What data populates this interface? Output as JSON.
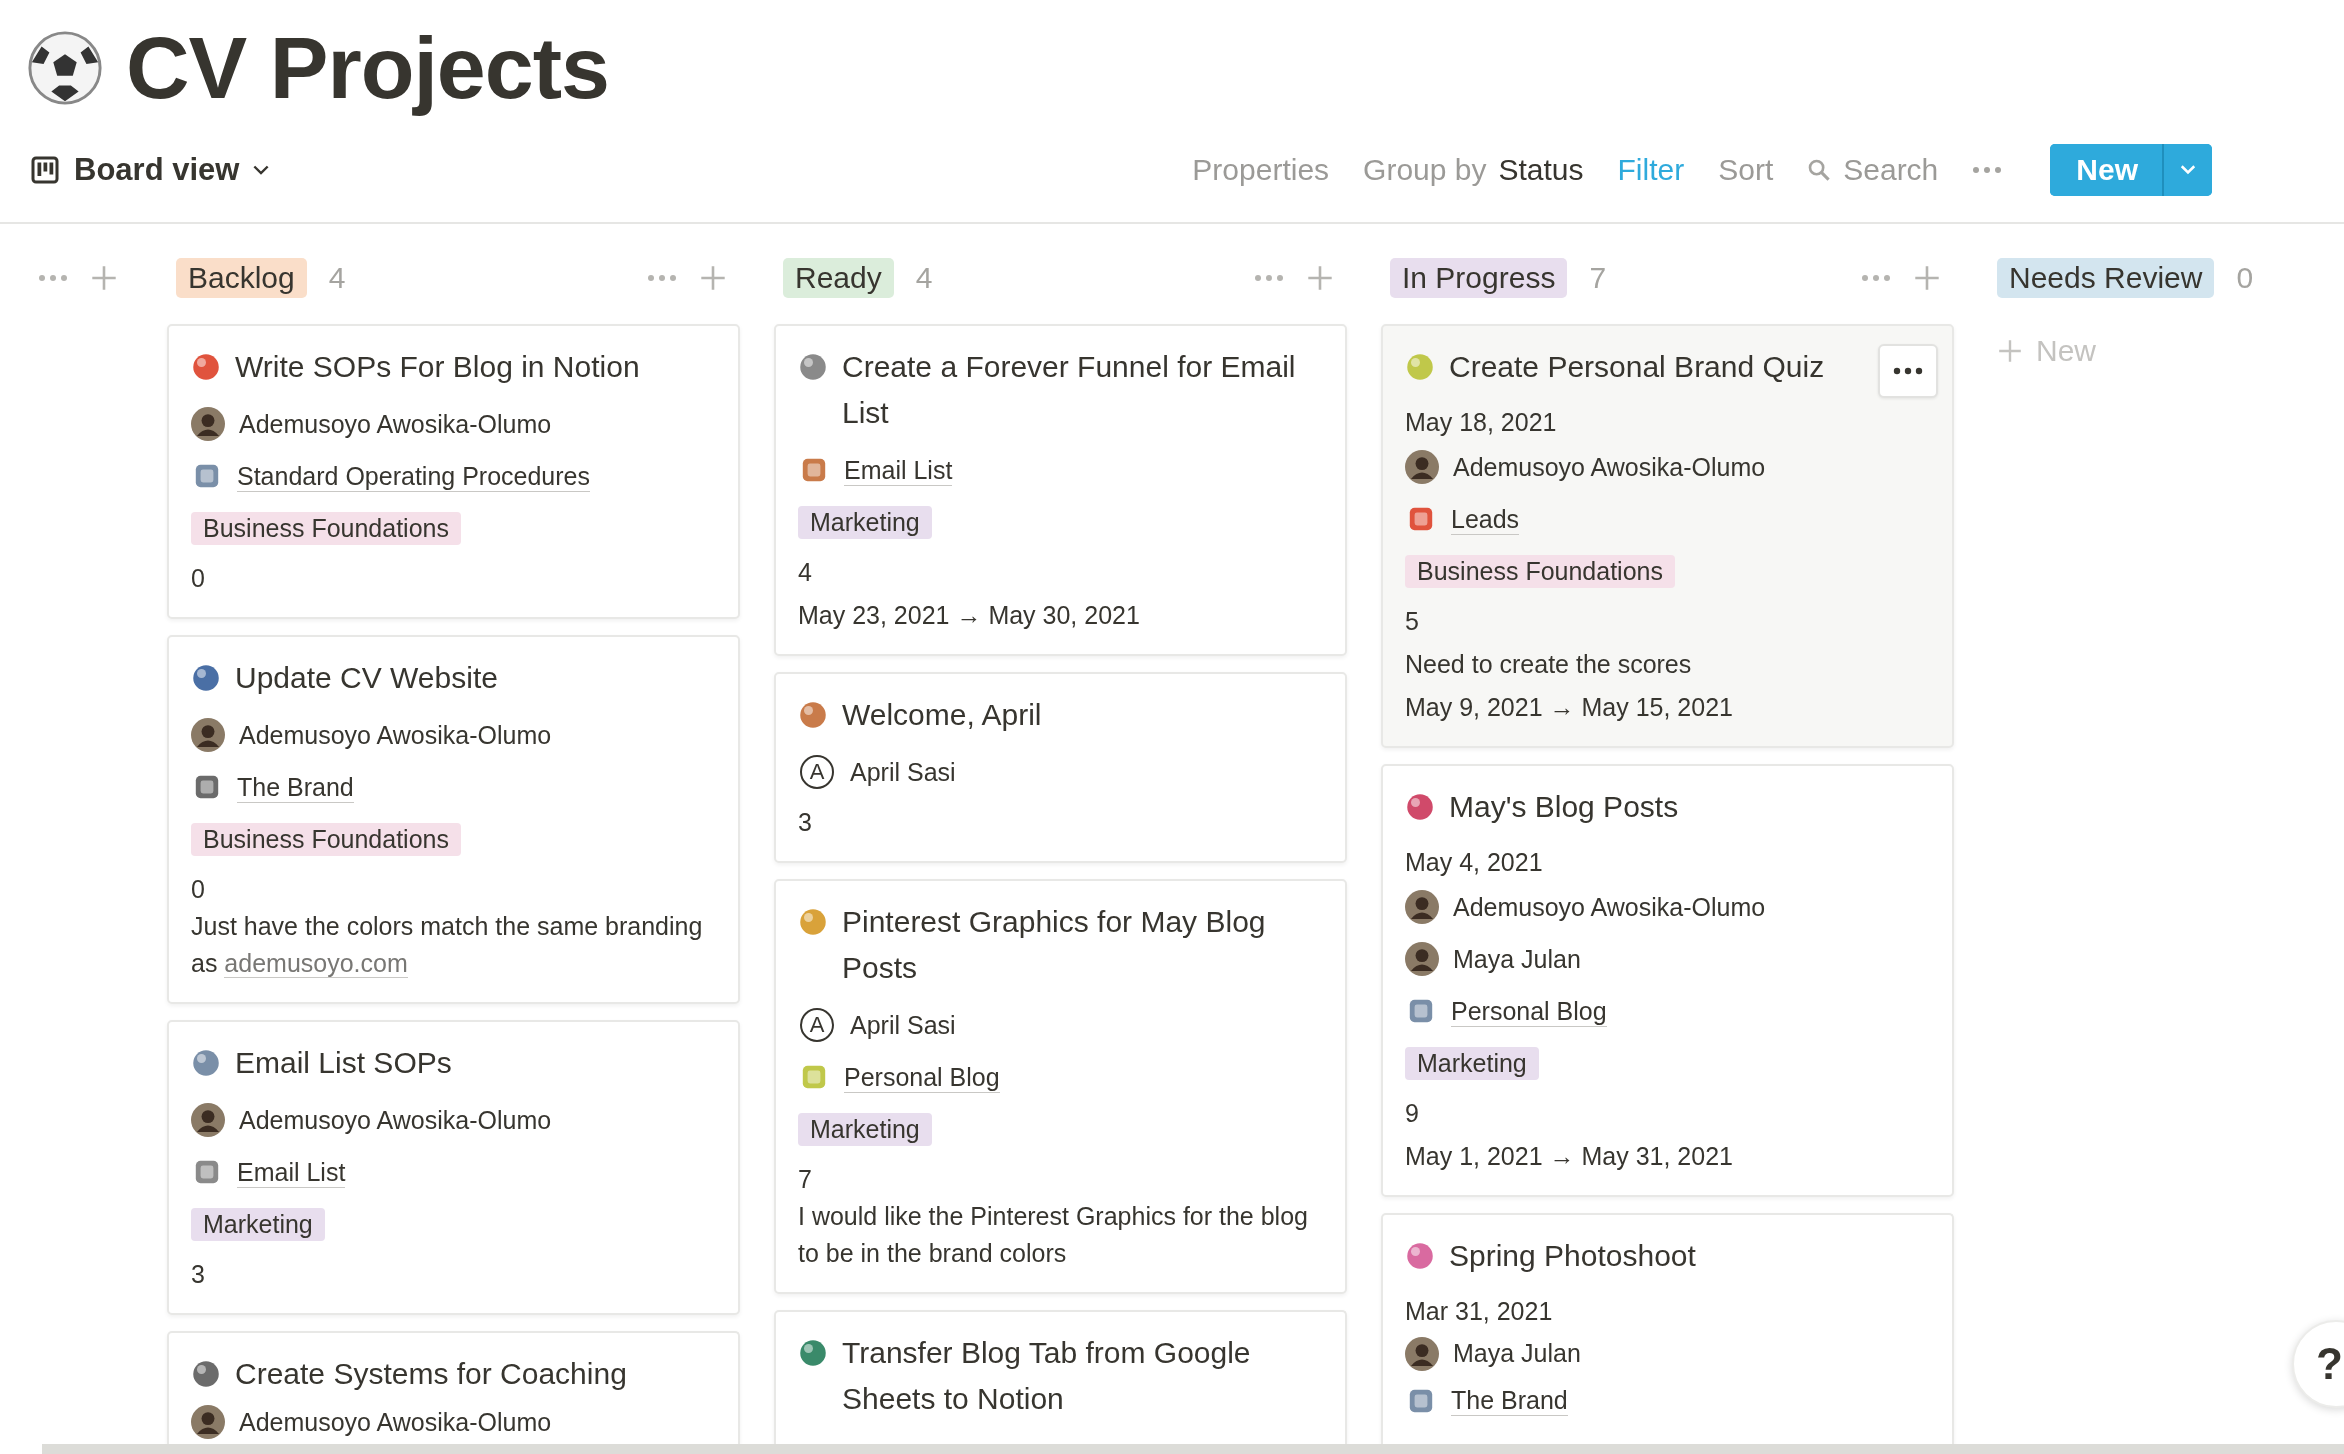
{
  "page": {
    "title": "CV Projects"
  },
  "toolbar": {
    "view": "Board view",
    "items": [
      {
        "kind": "plain",
        "label": "Properties"
      },
      {
        "kind": "group",
        "label": "Group by",
        "value": "Status"
      },
      {
        "kind": "active",
        "label": "Filter"
      },
      {
        "kind": "plain",
        "label": "Sort"
      },
      {
        "kind": "search",
        "label": "Search"
      }
    ],
    "new_button": "New"
  },
  "columns": [
    {
      "name": "Backlog",
      "color": "#fadec9",
      "count": "4",
      "cards": [
        {
          "title": "Write SOPs For Blog in Notion",
          "hovered": false,
          "props": [
            {
              "kind": "person",
              "name": "Ademusoyo Awosika-Olumo"
            },
            {
              "kind": "relation",
              "text": "Standard Operating Procedures"
            },
            {
              "kind": "tag",
              "text": "Business Foundations",
              "color": "#f5e0e9"
            },
            {
              "kind": "text",
              "text": "0"
            }
          ]
        },
        {
          "title": "Update CV Website",
          "hovered": false,
          "props": [
            {
              "kind": "person",
              "name": "Ademusoyo Awosika-Olumo"
            },
            {
              "kind": "relation",
              "text": "The Brand"
            },
            {
              "kind": "tag",
              "text": "Business Foundations",
              "color": "#f5e0e9"
            },
            {
              "kind": "text",
              "text": "0"
            },
            {
              "kind": "note",
              "text": "Just have the colors match the same branding as",
              "link": "ademusoyo.com"
            }
          ]
        },
        {
          "title": "Email List SOPs",
          "hovered": false,
          "props": [
            {
              "kind": "person",
              "name": "Ademusoyo Awosika-Olumo"
            },
            {
              "kind": "relation",
              "text": "Email List"
            },
            {
              "kind": "tag",
              "text": "Marketing",
              "color": "#e8deee"
            },
            {
              "kind": "text",
              "text": "3"
            }
          ]
        },
        {
          "title": "Create Systems for Coaching",
          "hovered": false,
          "props": [
            {
              "kind": "person",
              "name": "Ademusoyo Awosika-Olumo"
            }
          ]
        }
      ]
    },
    {
      "name": "Ready",
      "color": "#dbeddb",
      "count": "4",
      "cards": [
        {
          "title": "Create a Forever Funnel for Email List",
          "hovered": false,
          "props": [
            {
              "kind": "relation",
              "text": "Email List"
            },
            {
              "kind": "tag",
              "text": "Marketing",
              "color": "#e8deee"
            },
            {
              "kind": "text",
              "text": "4"
            },
            {
              "kind": "text",
              "text": "May 23, 2021 → May 30, 2021"
            }
          ]
        },
        {
          "title": "Welcome, April",
          "hovered": false,
          "props": [
            {
              "kind": "person",
              "name": "April Sasi",
              "initial": "A"
            },
            {
              "kind": "text",
              "text": "3"
            }
          ]
        },
        {
          "title": "Pinterest Graphics for May Blog Posts",
          "hovered": false,
          "props": [
            {
              "kind": "person",
              "name": "April Sasi",
              "initial": "A"
            },
            {
              "kind": "relation",
              "text": "Personal Blog"
            },
            {
              "kind": "tag",
              "text": "Marketing",
              "color": "#e8deee"
            },
            {
              "kind": "text",
              "text": "7"
            },
            {
              "kind": "note",
              "text": "I would like the Pinterest Graphics for the blog to be in the brand colors"
            }
          ]
        },
        {
          "title": "Transfer Blog Tab from Google Sheets to Notion",
          "hovered": false
        }
      ]
    },
    {
      "name": "In Progress",
      "color": "#e8deee",
      "count": "7",
      "cards": [
        {
          "title": "Create Personal Brand Quiz",
          "hovered": true,
          "props": [
            {
              "kind": "text",
              "text": "May 18, 2021"
            },
            {
              "kind": "person",
              "name": "Ademusoyo Awosika-Olumo"
            },
            {
              "kind": "relation",
              "text": "Leads"
            },
            {
              "kind": "tag",
              "text": "Business Foundations",
              "color": "#f5e0e9"
            },
            {
              "kind": "text",
              "text": "5"
            },
            {
              "kind": "text",
              "text": "Need to create the scores"
            },
            {
              "kind": "text",
              "text": "May 9, 2021 → May 15, 2021"
            }
          ]
        },
        {
          "title": "May's Blog Posts",
          "hovered": false,
          "props": [
            {
              "kind": "text",
              "text": "May 4, 2021"
            },
            {
              "kind": "person",
              "name": "Ademusoyo Awosika-Olumo"
            },
            {
              "kind": "person",
              "name": "Maya Julan"
            },
            {
              "kind": "relation",
              "text": "Personal Blog"
            },
            {
              "kind": "tag",
              "text": "Marketing",
              "color": "#e8deee"
            },
            {
              "kind": "text",
              "text": "9"
            },
            {
              "kind": "text",
              "text": "May 1, 2021 → May 31, 2021"
            }
          ]
        },
        {
          "title": "Spring Photoshoot",
          "hovered": false,
          "props": [
            {
              "kind": "text",
              "text": "Mar 31, 2021"
            },
            {
              "kind": "person",
              "name": "Maya Julan"
            },
            {
              "kind": "relation",
              "text": "The Brand"
            }
          ]
        }
      ]
    },
    {
      "name": "Needs Review",
      "color": "#d3e5ef",
      "count": "0",
      "new_label": "New"
    }
  ],
  "help_button": "?"
}
